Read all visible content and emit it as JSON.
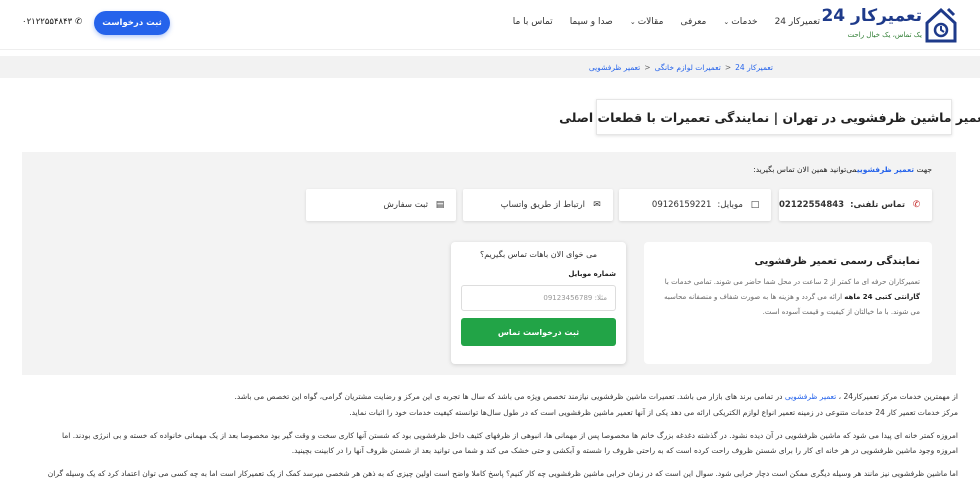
{
  "header": {
    "logo_text": "تعمیرکار 24",
    "logo_tagline": "یک تماس، یک خیال راحت",
    "nav": [
      {
        "label": "تعمیرکار 24",
        "dropdown": false
      },
      {
        "label": "خدمات",
        "dropdown": true
      },
      {
        "label": "معرفی",
        "dropdown": false
      },
      {
        "label": "مقالات",
        "dropdown": true
      },
      {
        "label": "صدا و سیما",
        "dropdown": false
      },
      {
        "label": "تماس با ما",
        "dropdown": false
      }
    ],
    "request_button": "ثبت درخواست",
    "phone": "۰۲۱۲۲۵۵۴۸۴۳"
  },
  "breadcrumb": [
    "تعمیرکار 24",
    "تعمیرات لوازم خانگی",
    "تعمیر ظرفشویی"
  ],
  "page_title": "تعمیر ماشین ظرفشویی در تهران | نمایندگی تعمیرات با قطعات اصلی",
  "contact": {
    "lead_prefix": "جهت",
    "lead_highlight": "تعمیر ظرفشویی",
    "lead_suffix": "می‌توانید همین الان تماس بگیرید:",
    "cards": [
      {
        "label": "تماس تلفنی:",
        "value": "02122554843",
        "icon": "phone-icon"
      },
      {
        "label": "موبایل:",
        "value": "09126159221",
        "icon": "mobile-icon"
      },
      {
        "label": "ارتباط از طریق واتساپ",
        "value": "",
        "icon": "chat-icon"
      },
      {
        "label": "ثبت سفارش",
        "value": "",
        "icon": "clipboard-icon"
      }
    ]
  },
  "representative": {
    "title": "نمایندگی رسمی تعمیر ظرفشویی",
    "body_1": "تعمیرکاران حرفه ای ما کمتر از 2 ساعت در محل شما حاضر می شوند. تمامی خدمات با",
    "body_bold": "گارانتی کتبی 24 ماهه",
    "body_2": "ارائه می گردد و هزینه ها به صورت شفاف و منصفانه محاسبه می شوند. با ما خیالتان از کیفیت و قیمت آسوده است."
  },
  "form": {
    "question": "می خوای الان باهات تماس بگیریم؟",
    "mobile_label": "شماره موبایل",
    "mobile_placeholder": "مثلا: 09123456789",
    "submit": "ثبت درخواست تماس"
  },
  "paragraphs": {
    "p1_a": "از مهمترین خدمات مرکز تعمیرکار24 ،",
    "p1_link": "تعمیر ظرفشویی",
    "p1_b": "در تمامی برند های بازار می باشد. تعمیرات ماشین ظرفشویی نیازمند تخصص ویژه می باشد که سال ها تجربه ی این مرکز و رضایت مشتریان گرامی، گواه این تخصص می باشد.",
    "p2": "مرکز خدمات تعمیر کار 24 خدمات متنوعی در زمینه تعمیر انواع لوازم الکتریکی ارائه می دهد یکی از آنها تعمیر ماشین ظرفشویی است که در طول سال‌ها توانسته کیفیت خدمات خود را اثبات نماید.",
    "p3_l1": "امروزه کمتر خانه ای پیدا می شود که ماشین ظرفشویی در آن دیده نشود. در گذشته دغدغه بزرگ خانم ها مخصوصا پس از مهمانی ها، انبوهی از ظرفهای کثیف داخل ظرفشویی بود که شستن آنها کاری سخت و وقت گیر بود مخصوصا بعد از یک مهمانی خانواده که خسته و بی انرژی بودند. اما",
    "p3_l2": "امروزه وجود ماشین ظرفشویی در هر خانه ای کار را برای شستن ظروف راحت کرده است که به راحتی ظروف را شسته و آبکشی و حتی خشک می کند و شما می توانید بعد از شستن ظروف آنها را در کابینت بچینید.",
    "p4": "اما ماشین ظرفشویی نیز مانند هر وسیله دیگری ممکن است دچار خرابی شود. سوال این است که در زمان خرابی ماشین ظرفشویی چه کار کنیم؟ پاسخ کاملا واضح است اولین چیزی که به ذهن هر شخصی میرسد کمک از یک تعمیرکار است اما به چه کسی می توان اعتماد کرد که یک وسیله گران"
  },
  "colors": {
    "primary": "#2563eb",
    "success": "#22a447",
    "logo": "#1e3a8a"
  }
}
